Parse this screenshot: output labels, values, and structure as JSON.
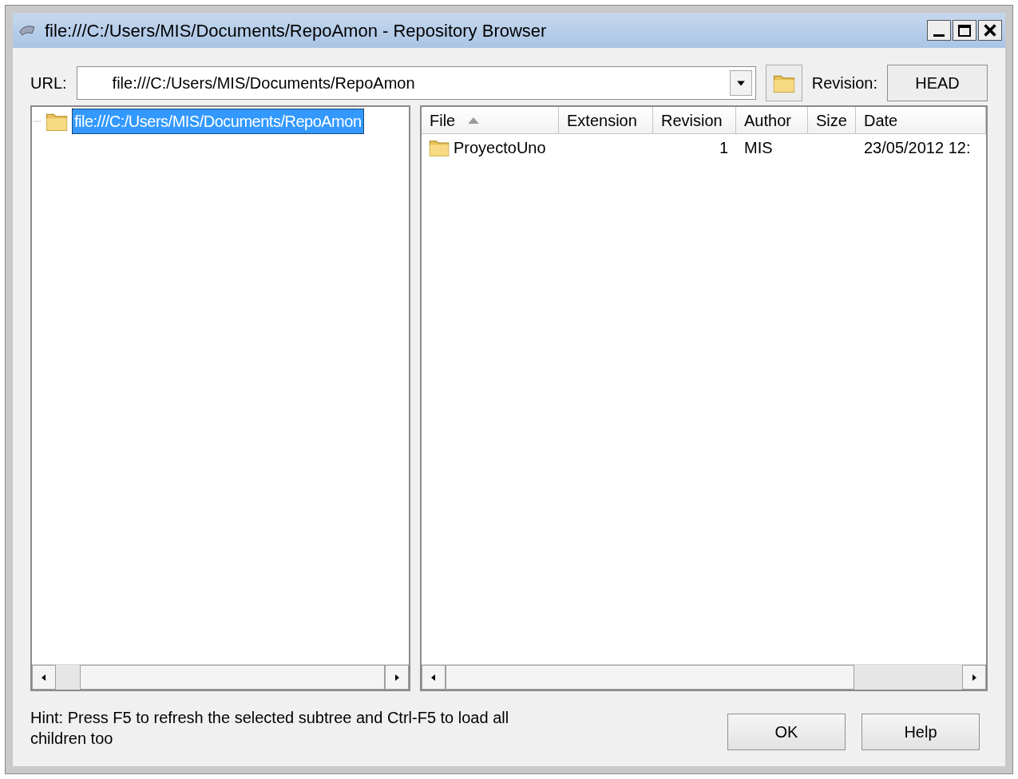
{
  "window": {
    "title": "file:///C:/Users/MIS/Documents/RepoAmon - Repository Browser"
  },
  "url": {
    "label": "URL:",
    "value": "file:///C:/Users/MIS/Documents/RepoAmon"
  },
  "revision": {
    "label": "Revision:",
    "button": "HEAD"
  },
  "tree": {
    "items": [
      {
        "label": "file:///C:/Users/MIS/Documents/RepoAmon",
        "selected": true
      }
    ]
  },
  "table": {
    "columns": [
      {
        "label": "File",
        "sorted": true
      },
      {
        "label": "Extension",
        "sorted": false
      },
      {
        "label": "Revision",
        "sorted": false
      },
      {
        "label": "Author",
        "sorted": false
      },
      {
        "label": "Size",
        "sorted": false
      },
      {
        "label": "Date",
        "sorted": false
      }
    ],
    "rows": [
      {
        "cells": [
          "ProyectoUno",
          null,
          "1",
          "MIS",
          null,
          "23/05/2012 12:"
        ]
      }
    ]
  },
  "hint": "Hint: Press F5 to refresh the selected subtree and Ctrl-F5 to load all children too",
  "buttons": [
    "OK",
    "Help"
  ]
}
